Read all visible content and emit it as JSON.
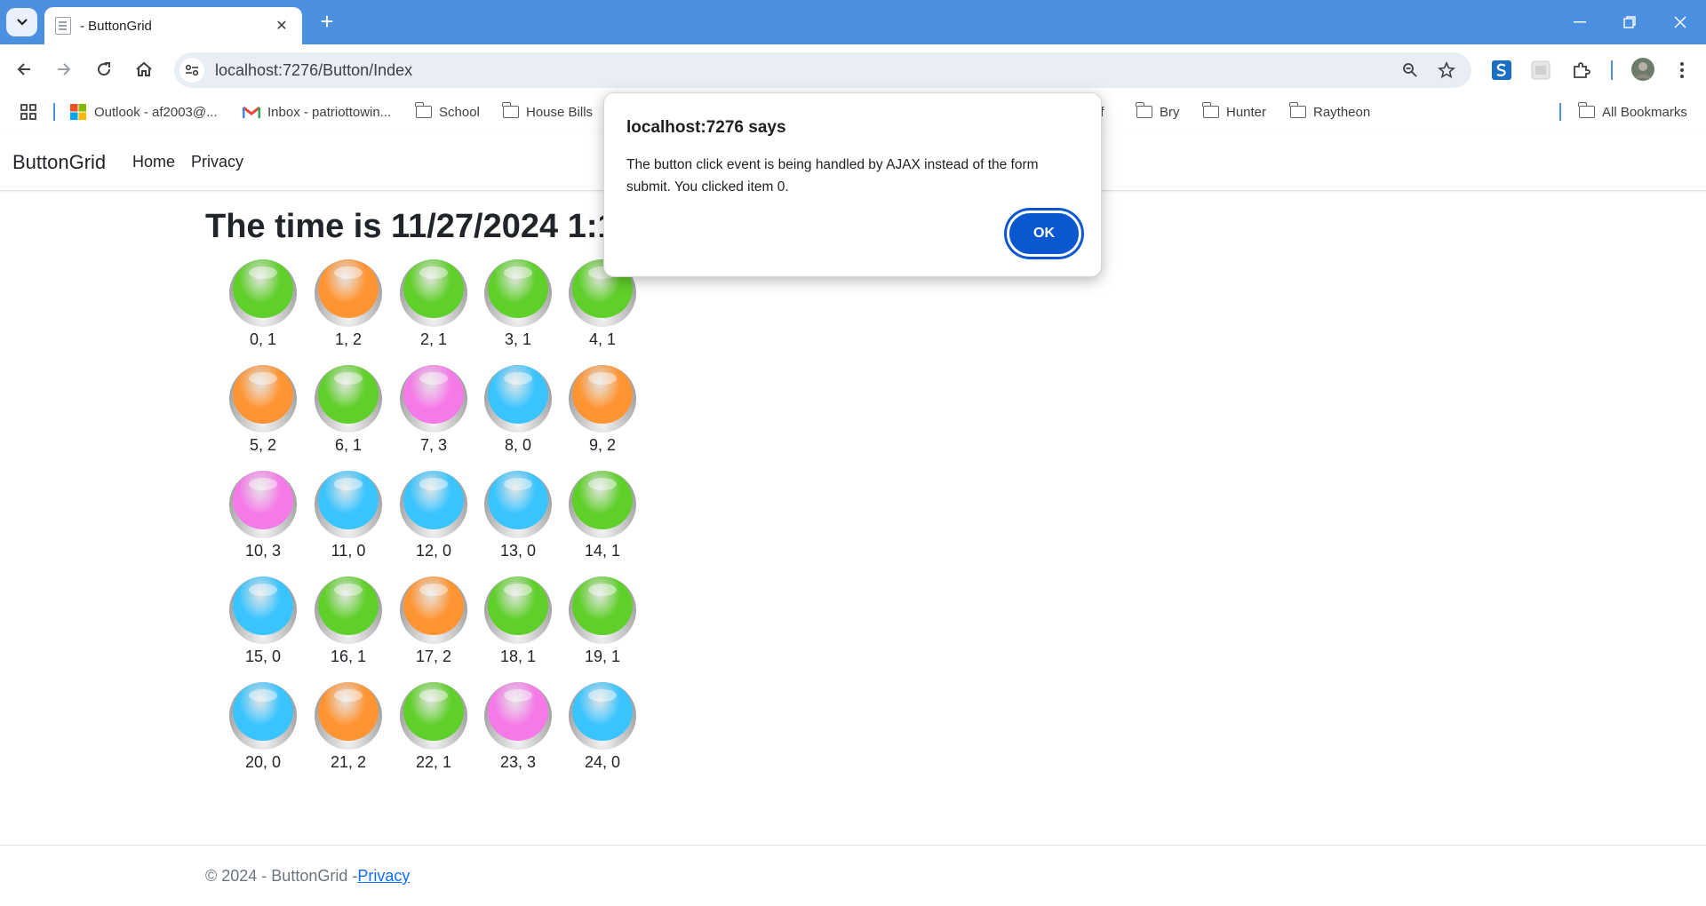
{
  "browser": {
    "tab_title": "- ButtonGrid",
    "url": "localhost:7276/Button/Index",
    "bookmarks": [
      {
        "label": "Outlook - af2003@...",
        "icon": "ms-logo-icon"
      },
      {
        "label": "Inbox - patriottowin...",
        "icon": "gmail-icon"
      },
      {
        "label": "School",
        "icon": "folder-icon"
      },
      {
        "label": "House Bills",
        "icon": "folder-icon"
      },
      {
        "label": "uff",
        "icon": "folder-icon"
      },
      {
        "label": "Bry",
        "icon": "folder-icon"
      },
      {
        "label": "Hunter",
        "icon": "folder-icon"
      },
      {
        "label": "Raytheon",
        "icon": "folder-icon"
      }
    ],
    "all_bookmarks": "All Bookmarks"
  },
  "site": {
    "brand": "ButtonGrid",
    "nav": [
      "Home",
      "Privacy"
    ],
    "heading": "The time is 11/27/2024 1:11:1",
    "footer_prefix": "© 2024 - ButtonGrid -",
    "footer_link": "Privacy"
  },
  "colors": {
    "0": "#39c4ff",
    "1": "#5fcf2a",
    "2": "#ff9433",
    "3": "#f57ae8"
  },
  "grid": [
    {
      "label": "0, 1",
      "state": 1
    },
    {
      "label": "1, 2",
      "state": 2
    },
    {
      "label": "2, 1",
      "state": 1
    },
    {
      "label": "3, 1",
      "state": 1
    },
    {
      "label": "4, 1",
      "state": 1
    },
    {
      "label": "5, 2",
      "state": 2
    },
    {
      "label": "6, 1",
      "state": 1
    },
    {
      "label": "7, 3",
      "state": 3
    },
    {
      "label": "8, 0",
      "state": 0
    },
    {
      "label": "9, 2",
      "state": 2
    },
    {
      "label": "10, 3",
      "state": 3
    },
    {
      "label": "11, 0",
      "state": 0
    },
    {
      "label": "12, 0",
      "state": 0
    },
    {
      "label": "13, 0",
      "state": 0
    },
    {
      "label": "14, 1",
      "state": 1
    },
    {
      "label": "15, 0",
      "state": 0
    },
    {
      "label": "16, 1",
      "state": 1
    },
    {
      "label": "17, 2",
      "state": 2
    },
    {
      "label": "18, 1",
      "state": 1
    },
    {
      "label": "19, 1",
      "state": 1
    },
    {
      "label": "20, 0",
      "state": 0
    },
    {
      "label": "21, 2",
      "state": 2
    },
    {
      "label": "22, 1",
      "state": 1
    },
    {
      "label": "23, 3",
      "state": 3
    },
    {
      "label": "24, 0",
      "state": 0
    }
  ],
  "dialog": {
    "title": "localhost:7276 says",
    "message": "The button click event is being handled by AJAX instead of the form submit. You clicked item 0.",
    "ok": "OK"
  }
}
